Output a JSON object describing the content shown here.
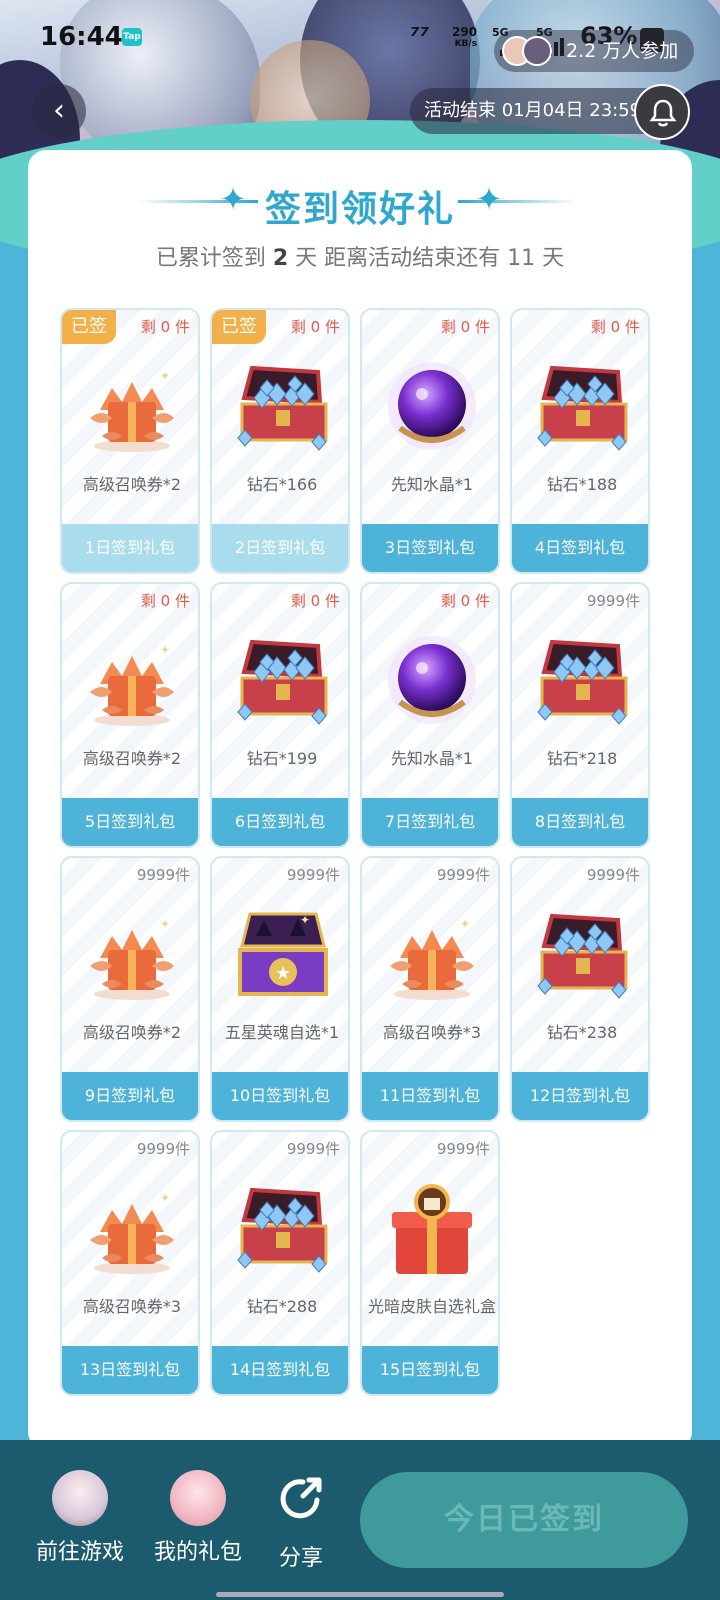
{
  "status_bar": {
    "time": "16:44",
    "app_badge": "Tap",
    "net_speed_value": "290",
    "net_speed_unit": "KB/s",
    "sim1": "5G",
    "sim2": "5G",
    "battery": "63%"
  },
  "header": {
    "participants": "2.2 万人参加",
    "back_icon": "chevron-left-icon",
    "activity_end": "活动结束 01月04日 23:59",
    "bell_icon": "bell-icon"
  },
  "card": {
    "title": "签到领好礼",
    "subtitle_prefix": "已累计签到",
    "signed_days": "2",
    "subtitle_mid": "天  距离活动结束还有",
    "days_left": "11",
    "subtitle_suffix": "天"
  },
  "gifts": [
    {
      "signed_badge": "已签",
      "stock": "剩 0 件",
      "icon": "summon-ticket-icon",
      "name": "高级召唤券*2",
      "label": "1日签到礼包"
    },
    {
      "signed_badge": "已签",
      "stock": "剩 0 件",
      "icon": "diamond-chest-icon",
      "name": "钻石*166",
      "label": "2日签到礼包"
    },
    {
      "signed_badge": "",
      "stock": "剩 0 件",
      "icon": "crystal-orb-icon",
      "name": "先知水晶*1",
      "label": "3日签到礼包"
    },
    {
      "signed_badge": "",
      "stock": "剩 0 件",
      "icon": "diamond-chest-icon",
      "name": "钻石*188",
      "label": "4日签到礼包"
    },
    {
      "signed_badge": "",
      "stock": "剩 0 件",
      "icon": "summon-ticket-icon",
      "name": "高级召唤券*2",
      "label": "5日签到礼包"
    },
    {
      "signed_badge": "",
      "stock": "剩 0 件",
      "icon": "diamond-chest-icon",
      "name": "钻石*199",
      "label": "6日签到礼包"
    },
    {
      "signed_badge": "",
      "stock": "剩 0 件",
      "icon": "crystal-orb-icon",
      "name": "先知水晶*1",
      "label": "7日签到礼包"
    },
    {
      "signed_badge": "",
      "stock": "9999件",
      "icon": "diamond-chest-icon",
      "name": "钻石*218",
      "label": "8日签到礼包"
    },
    {
      "signed_badge": "",
      "stock": "9999件",
      "icon": "summon-ticket-icon",
      "name": "高级召唤券*2",
      "label": "9日签到礼包"
    },
    {
      "signed_badge": "",
      "stock": "9999件",
      "icon": "hero-soul-chest-icon",
      "name": "五星英魂自选*1",
      "label": "10日签到礼包"
    },
    {
      "signed_badge": "",
      "stock": "9999件",
      "icon": "summon-ticket-icon",
      "name": "高级召唤券*3",
      "label": "11日签到礼包"
    },
    {
      "signed_badge": "",
      "stock": "9999件",
      "icon": "diamond-chest-icon",
      "name": "钻石*238",
      "label": "12日签到礼包"
    },
    {
      "signed_badge": "",
      "stock": "9999件",
      "icon": "summon-ticket-icon",
      "name": "高级召唤券*3",
      "label": "13日签到礼包"
    },
    {
      "signed_badge": "",
      "stock": "9999件",
      "icon": "diamond-chest-icon",
      "name": "钻石*288",
      "label": "14日签到礼包"
    },
    {
      "signed_badge": "",
      "stock": "9999件",
      "icon": "skin-gift-box-icon",
      "name": "光暗皮肤自选礼盒",
      "label": "15日签到礼包"
    }
  ],
  "bottom_bar": {
    "go_game": "前往游戏",
    "my_gifts": "我的礼包",
    "share": "分享",
    "signed_today": "今日已签到"
  },
  "colors": {
    "accent": "#2ea8cf",
    "tile_footer": "#4db3d8",
    "tile_footer_done": "#a9dcec",
    "signed_badge": "#f2b04b",
    "stock_red": "#e25a4e",
    "bottom_bar": "#1c5a6e",
    "sign_button": "#3f9a9b"
  }
}
